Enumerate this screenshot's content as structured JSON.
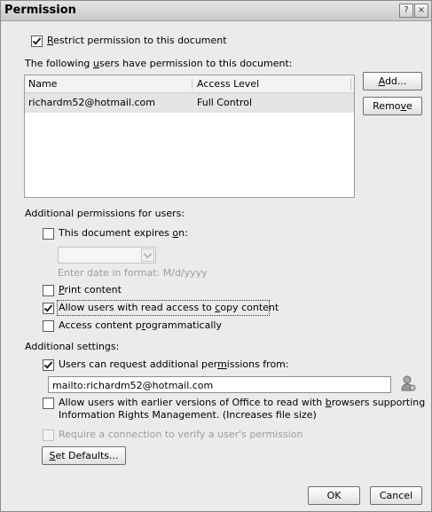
{
  "dialog": {
    "title": "Permission",
    "help_glyph": "?",
    "close_glyph": "×"
  },
  "restrict": {
    "checked": true,
    "label": {
      "pre": "",
      "key": "R",
      "post": "estrict permission to this document"
    }
  },
  "users_caption": {
    "pre": "The following ",
    "key": "u",
    "post": "sers have permission to this document:"
  },
  "user_list": {
    "columns": [
      "Name",
      "Access Level"
    ],
    "rows": [
      {
        "name": "richardm52@hotmail.com",
        "access": "Full Control"
      }
    ]
  },
  "buttons": {
    "add": {
      "pre": "",
      "key": "A",
      "post": "dd..."
    },
    "remove": {
      "pre": "Remo",
      "key": "v",
      "post": "e"
    },
    "set_defaults": {
      "pre": "",
      "key": "S",
      "post": "et Defaults..."
    },
    "ok": "OK",
    "cancel": "Cancel"
  },
  "additional_permissions": {
    "heading": "Additional permissions for users:",
    "expires": {
      "checked": false,
      "label": {
        "pre": "This document expires ",
        "key": "o",
        "post": "n:"
      }
    },
    "date_value": "",
    "date_hint": "Enter date in format: M/d/yyyy",
    "print": {
      "checked": false,
      "label": {
        "pre": "",
        "key": "P",
        "post": "rint content"
      }
    },
    "copy": {
      "checked": true,
      "label": {
        "pre": "Allow users with read access to ",
        "key": "c",
        "post": "opy content"
      }
    },
    "programmatic": {
      "checked": false,
      "label": {
        "pre": "Access content p",
        "key": "r",
        "post": "ogrammatically"
      }
    }
  },
  "additional_settings": {
    "heading": "Additional settings:",
    "request": {
      "checked": true,
      "label": {
        "pre": "Users can request additional per",
        "key": "m",
        "post": "issions from:"
      }
    },
    "request_address": "mailto:richardm52@hotmail.com",
    "browsers": {
      "checked": false,
      "line1": {
        "pre": "Allow users with earlier versions of Office to read with ",
        "key": "b",
        "post": "rowsers supporting"
      },
      "line2": "Information Rights Management. (Increases file size)"
    },
    "require_connection": {
      "checked": false,
      "enabled": false,
      "label": "Require a connection to verify a user's permission"
    }
  },
  "icons": {
    "address_book": "address-book-icon",
    "help": "help-icon",
    "close": "close-icon"
  }
}
